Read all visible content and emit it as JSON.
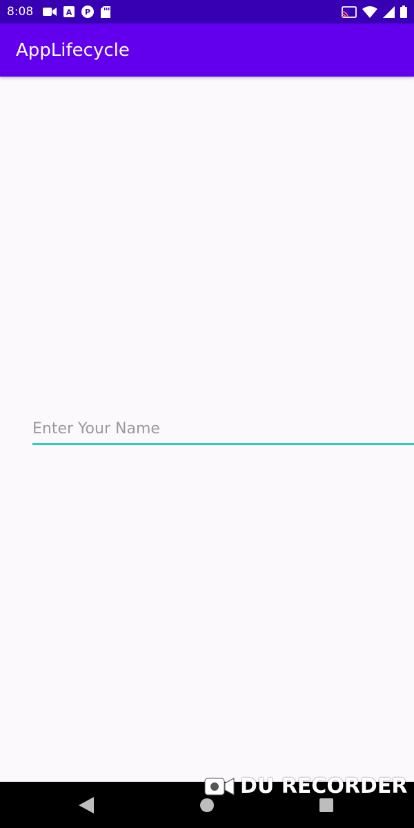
{
  "status_bar": {
    "time": "8:08",
    "left_icons": [
      "video-camera-icon",
      "a-letter-icon",
      "p-circle-icon",
      "sd-card-icon"
    ],
    "right_icons": [
      "cast-icon",
      "wifi-icon",
      "cellular-signal-icon",
      "battery-icon"
    ]
  },
  "app_bar": {
    "title": "AppLifecycle",
    "color": "#6200ee"
  },
  "main": {
    "name_input": {
      "value": "",
      "placeholder": "Enter Your Name",
      "underline_color": "#2ad0bd"
    }
  },
  "nav_bar": {
    "buttons": [
      "back-icon",
      "home-icon",
      "recents-icon"
    ]
  },
  "watermark": {
    "text": "DU RECORDER",
    "icon": "recorder-camera-icon"
  }
}
